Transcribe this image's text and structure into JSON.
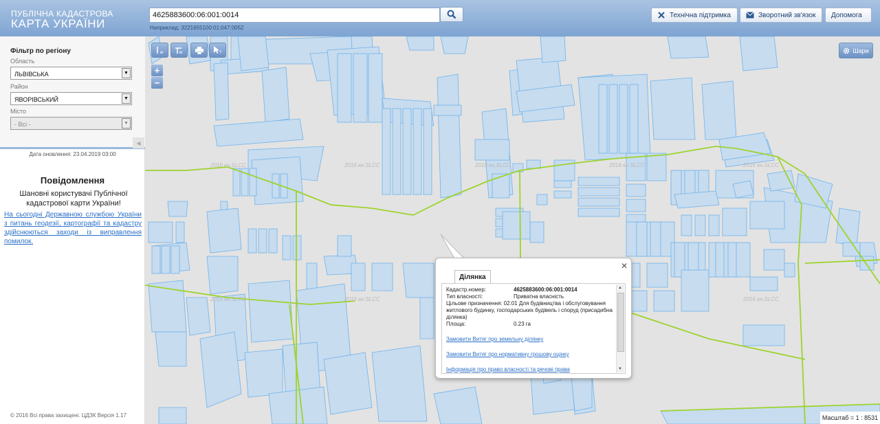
{
  "header": {
    "logo_line1": "ПУБЛІЧНА КАДАСТРОВА",
    "logo_line2": "КАРТА УКРАЇНИ",
    "search_value": "4625883600:06:001:0014",
    "search_example": "Наприклад: 3221655100:01:047:0052",
    "btn_support": "Технічна підтримка",
    "btn_feedback": "Зворотний зв'язок",
    "btn_help": "Допомога"
  },
  "sidebar": {
    "filter_title": "Фільтр по регіону",
    "oblast_label": "Область",
    "oblast_value": "ЛЬВІВСЬКА",
    "raion_label": "Район",
    "raion_value": "ЯВОРІВСЬКИЙ",
    "misto_label": "Місто",
    "misto_value": "- Всі -",
    "updated": "Дата оновлення: 23.04.2019 03:00",
    "notice_title": "Повідомлення",
    "notice_body": "Шановні користувачі Публічної кадастрової карти України!",
    "notice_link": "На сьогодні Державною службою України з питань геодезії, картографії та кадастру здійснюються заходи із виправлення помилок.",
    "copyright": "© 2016 Всі права захищені. ЦДЗК Версія 1.17"
  },
  "map": {
    "layers_label": "Шари",
    "scale": "Масштаб = 1 : 8531",
    "watermark": "2016 кн.SLCC"
  },
  "popup": {
    "tab": "Ділянка",
    "rows": [
      {
        "k": "Кадастр.номер:",
        "v": "4625883600:06:001:0014"
      },
      {
        "k": "Тип власності:",
        "v": "Приватна власність"
      },
      {
        "k": "Цільове призначення:",
        "v": "02.01 Для будівництва і обслуговування житлового будинку, господарських будівель і споруд (присадибна ділянка)"
      },
      {
        "k": "Площа:",
        "v": "0.23 га"
      }
    ],
    "link1": "Замовити Витяг про земельну ділянку",
    "link2": "Замовити Витяг про нормативну грошову оцінку",
    "link3": "Інформація про право власності та речові права"
  },
  "colors": {
    "parcel_fill": "#c7dcef",
    "parcel_stroke": "#6fb2ea",
    "boundary": "#9dd32d",
    "header": "#8fb0d9"
  }
}
